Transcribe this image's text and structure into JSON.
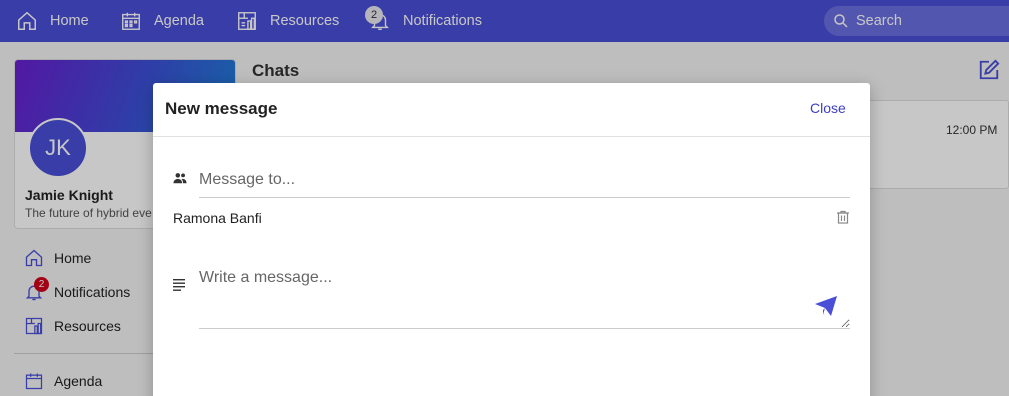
{
  "topnav": {
    "home_label": "Home",
    "agenda_label": "Agenda",
    "resources_label": "Resources",
    "notifications_label": "Notifications",
    "notifications_count": "2",
    "search_placeholder": "Search"
  },
  "profile": {
    "initials": "JK",
    "name": "Jamie Knight",
    "tagline": "The future of hybrid eve"
  },
  "sidebar": {
    "items": [
      {
        "label": "Home",
        "icon": "home-icon"
      },
      {
        "label": "Notifications",
        "icon": "bell-icon",
        "badge": "2"
      },
      {
        "label": "Resources",
        "icon": "resources-icon"
      },
      {
        "label": "Agenda",
        "icon": "calendar-icon"
      }
    ]
  },
  "chats": {
    "title": "Chats",
    "time": "12:00 PM"
  },
  "modal": {
    "title": "New message",
    "close_label": "Close",
    "to_placeholder": "Message to...",
    "recipient": "Ramona Banfi",
    "message_placeholder": "Write a message..."
  },
  "colors": {
    "accent": "#4a4fd6",
    "link": "#3b3fc4",
    "badge_red": "#d0021b"
  }
}
